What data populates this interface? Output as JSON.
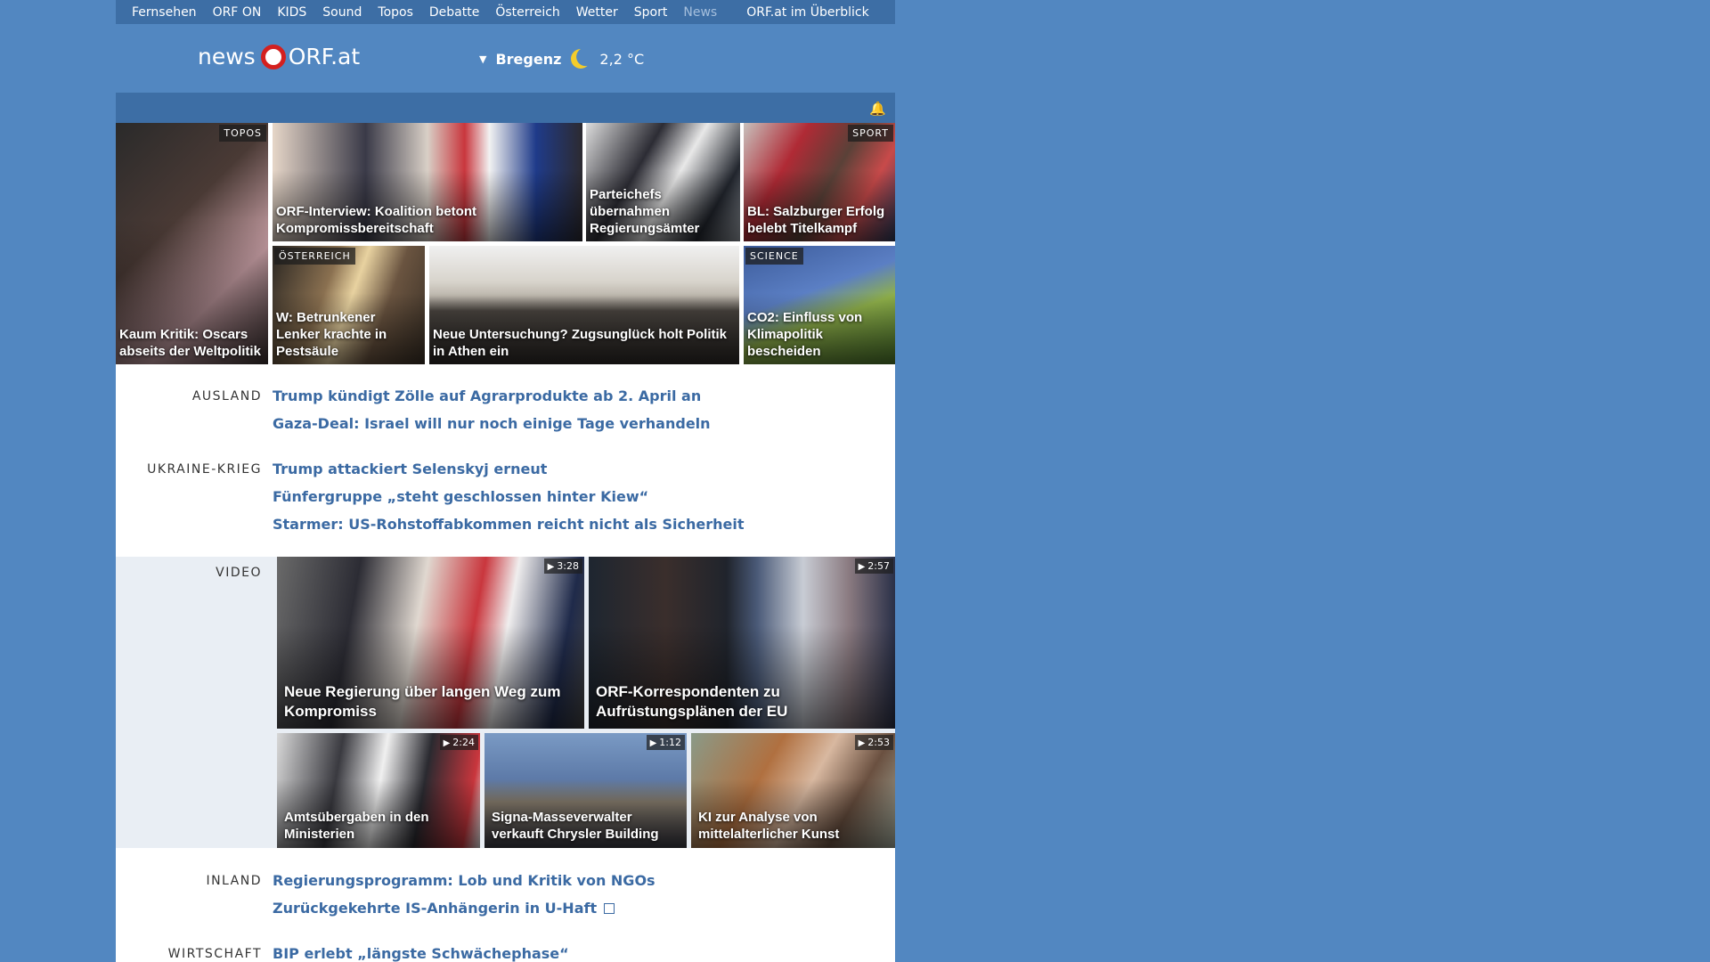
{
  "nav": {
    "items": [
      "Fernsehen",
      "ORF ON",
      "KIDS",
      "Sound",
      "Topos",
      "Debatte",
      "Österreich",
      "Wetter",
      "Sport"
    ],
    "current": "News",
    "overview": "ORF.at im Überblick"
  },
  "header": {
    "logo_news": "news",
    "logo_orf": "ORF.at",
    "weather_location": "Bregenz",
    "weather_temp": "2,2 °C",
    "weather_icon": "moon-icon",
    "bell_icon": "bell-icon"
  },
  "teasers": [
    {
      "tag": "TOPOS",
      "title": "Kaum Kritik: Oscars abseits der Weltpolitik"
    },
    {
      "tag": "",
      "title": "ORF-Interview: Koalition betont Kompromissbereitschaft"
    },
    {
      "tag": "",
      "title": "Parteichefs übernahmen Regierungsämter"
    },
    {
      "tag": "SPORT",
      "title": "BL: Salzburger Erfolg belebt Titelkampf"
    },
    {
      "tag": "ÖSTERREICH",
      "title": "W: Betrunkener Lenker krachte in Pestsäule"
    },
    {
      "tag": "",
      "title": "Neue Untersuchung? Zugsunglück holt Politik in Athen ein"
    },
    {
      "tag": "SCIENCE",
      "title": "CO2: Einfluss von Klimapolitik bescheiden"
    }
  ],
  "sections": {
    "ausland": {
      "label": "AUSLAND",
      "headlines": [
        "Trump kündigt Zölle auf Agrarprodukte ab 2. April an",
        "Gaza-Deal: Israel will nur noch einige Tage verhandeln"
      ]
    },
    "ukraine": {
      "label": "UKRAINE-KRIEG",
      "headlines": [
        "Trump attackiert Selenskyj erneut",
        "Fünfergruppe „steht geschlossen hinter Kiew“",
        "Starmer: US-Rohstoffabkommen reicht nicht als Sicherheit"
      ]
    },
    "inland": {
      "label": "INLAND",
      "headlines": [
        "Regierungsprogramm: Lob und Kritik von NGOs",
        "Zurückgekehrte IS-Anhängerin in U-Haft"
      ]
    },
    "wirtschaft": {
      "label": "WIRTSCHAFT",
      "headlines": [
        "BIP erlebt „längste Schwächephase“"
      ]
    }
  },
  "video": {
    "label": "VIDEO",
    "items": [
      {
        "duration": "3:28",
        "title": "Neue Regierung über langen Weg zum Kompromiss"
      },
      {
        "duration": "2:57",
        "title": "ORF-Korrespondenten zu Aufrüstungsplänen der EU"
      },
      {
        "duration": "2:24",
        "title": "Amtsübergaben in den Ministerien"
      },
      {
        "duration": "1:12",
        "title": "Signa-Masseverwalter verkauft Chrysler Building"
      },
      {
        "duration": "2:53",
        "title": "KI zur Analyse von mittelalterlicher Kunst"
      }
    ]
  },
  "colors": {
    "background": "#5287c1",
    "nav_bar": "#3d6ea5",
    "link": "#3b6aa3",
    "brand_red": "#d4201f"
  }
}
